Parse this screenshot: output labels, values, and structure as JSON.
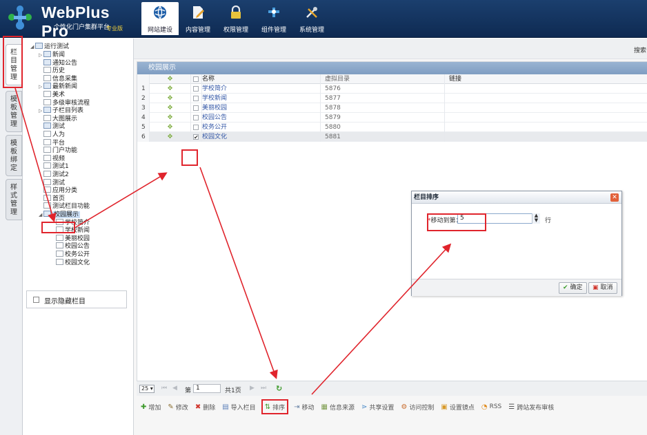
{
  "app": {
    "logo_title": "WebPlus Pro",
    "logo_subtitle": "个性化门户集群平台",
    "logo_badge": "专业版"
  },
  "nav": [
    {
      "label": "网站建设",
      "icon": "globe-icon",
      "active": true
    },
    {
      "label": "内容管理",
      "icon": "document-edit-icon",
      "active": false
    },
    {
      "label": "权限管理",
      "icon": "lock-icon",
      "active": false
    },
    {
      "label": "组件管理",
      "icon": "puzzle-icon",
      "active": false
    },
    {
      "label": "系统管理",
      "icon": "tools-icon",
      "active": false
    }
  ],
  "vtabs": [
    {
      "label": "栏目管理",
      "active": true
    },
    {
      "label": "模板管理",
      "active": false
    },
    {
      "label": "模板绑定",
      "active": false
    },
    {
      "label": "样式管理",
      "active": false
    }
  ],
  "tree": {
    "root": "运行测试",
    "nodes": [
      {
        "label": "新闻",
        "level": 1,
        "type": "folder",
        "arrow": "▷"
      },
      {
        "label": "通知公告",
        "level": 1,
        "type": "folder",
        "arrow": ""
      },
      {
        "label": "历史",
        "level": 1,
        "type": "page",
        "arrow": ""
      },
      {
        "label": "信息采集",
        "level": 1,
        "type": "page",
        "arrow": ""
      },
      {
        "label": "最新新闻",
        "level": 1,
        "type": "folder",
        "arrow": "▷"
      },
      {
        "label": "美术",
        "level": 1,
        "type": "page",
        "arrow": ""
      },
      {
        "label": "多级审核流程",
        "level": 1,
        "type": "page",
        "arrow": ""
      },
      {
        "label": "子栏目列表",
        "level": 1,
        "type": "folder",
        "arrow": "▷"
      },
      {
        "label": "大图展示",
        "level": 1,
        "type": "page",
        "arrow": ""
      },
      {
        "label": "测试",
        "level": 1,
        "type": "folder",
        "arrow": ""
      },
      {
        "label": "人为",
        "level": 1,
        "type": "page",
        "arrow": ""
      },
      {
        "label": "平台",
        "level": 1,
        "type": "page",
        "arrow": ""
      },
      {
        "label": "门户功能",
        "level": 1,
        "type": "page",
        "arrow": ""
      },
      {
        "label": "视频",
        "level": 1,
        "type": "page",
        "arrow": ""
      },
      {
        "label": "测试1",
        "level": 1,
        "type": "page",
        "arrow": ""
      },
      {
        "label": "测试2",
        "level": 1,
        "type": "page",
        "arrow": ""
      },
      {
        "label": "测试",
        "level": 1,
        "type": "page",
        "arrow": ""
      },
      {
        "label": "应用分类",
        "level": 1,
        "type": "page",
        "arrow": ""
      },
      {
        "label": "首页",
        "level": 1,
        "type": "page",
        "arrow": ""
      },
      {
        "label": "测试栏目功能",
        "level": 1,
        "type": "page",
        "arrow": ""
      },
      {
        "label": "校园展示",
        "level": 1,
        "type": "folder",
        "arrow": "◢",
        "selected": true
      },
      {
        "label": "学校简介",
        "level": 2,
        "type": "page",
        "arrow": ""
      },
      {
        "label": "学校新闻",
        "level": 2,
        "type": "page",
        "arrow": ""
      },
      {
        "label": "美丽校园",
        "level": 2,
        "type": "page",
        "arrow": ""
      },
      {
        "label": "校园公告",
        "level": 2,
        "type": "page",
        "arrow": ""
      },
      {
        "label": "校务公开",
        "level": 2,
        "type": "page",
        "arrow": ""
      },
      {
        "label": "校园文化",
        "level": 2,
        "type": "page",
        "arrow": ""
      }
    ],
    "show_hidden_label": "显示隐藏栏目"
  },
  "main": {
    "search_label": "搜索",
    "grid_title": "校园展示",
    "columns": {
      "name": "名称",
      "dir": "虚拟目录",
      "link": "链接"
    },
    "rows": [
      {
        "num": "1",
        "name": "学校简介",
        "dir": "5876",
        "link": "",
        "checked": false
      },
      {
        "num": "2",
        "name": "学校新闻",
        "dir": "5877",
        "link": "",
        "checked": false
      },
      {
        "num": "3",
        "name": "美丽校园",
        "dir": "5878",
        "link": "",
        "checked": false
      },
      {
        "num": "4",
        "name": "校园公告",
        "dir": "5879",
        "link": "",
        "checked": false
      },
      {
        "num": "5",
        "name": "校务公开",
        "dir": "5880",
        "link": "",
        "checked": false
      },
      {
        "num": "6",
        "name": "校园文化",
        "dir": "5881",
        "link": "",
        "checked": true
      }
    ],
    "pager": {
      "page_size": "25",
      "page_prefix": "第",
      "page_value": "1",
      "total": "共1页"
    },
    "toolbar": [
      {
        "label": "增加",
        "icon": "plus-icon",
        "glyph": "✚",
        "color": "#3e9a2c"
      },
      {
        "label": "修改",
        "icon": "pencil-icon",
        "glyph": "✎",
        "color": "#8a6d2e"
      },
      {
        "label": "删除",
        "icon": "delete-icon",
        "glyph": "✖",
        "color": "#d0342b"
      },
      {
        "label": "导入栏目",
        "icon": "import-icon",
        "glyph": "▤",
        "color": "#5a7fb8"
      },
      {
        "label": "排序",
        "icon": "sort-icon",
        "glyph": "⇅",
        "color": "#3e9a2c",
        "highlight": true
      },
      {
        "label": "移动",
        "icon": "move-icon",
        "glyph": "⇥",
        "color": "#6d87a8"
      },
      {
        "label": "信息来源",
        "icon": "source-icon",
        "glyph": "▦",
        "color": "#7a9a4a"
      },
      {
        "label": "共享设置",
        "icon": "share-icon",
        "glyph": "⋗",
        "color": "#4a8ac8"
      },
      {
        "label": "访问控制",
        "icon": "access-control-icon",
        "glyph": "⚙",
        "color": "#c86a2a"
      },
      {
        "label": "设置镜点",
        "icon": "mirror-icon",
        "glyph": "▣",
        "color": "#d89a2a"
      },
      {
        "label": "RSS",
        "icon": "rss-icon",
        "glyph": "◔",
        "color": "#e08a1a"
      },
      {
        "label": "跨站发布审核",
        "icon": "publish-review-icon",
        "glyph": "☰",
        "color": "#555"
      }
    ]
  },
  "dialog": {
    "title": "栏目排序",
    "field_label": "移动到第：",
    "field_value": "5",
    "unit": "行",
    "ok_label": "确定",
    "cancel_label": "取消"
  },
  "colors": {
    "header_bg": "#14356a",
    "grid_title_bg": "#8aa6c8",
    "annotation_red": "#e0242c",
    "link_blue": "#3357a6"
  }
}
